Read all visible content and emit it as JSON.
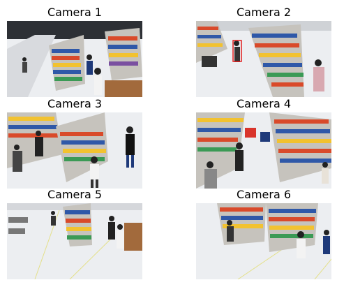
{
  "figure": {
    "cameras": [
      {
        "label": "Camera 1"
      },
      {
        "label": "Camera 2"
      },
      {
        "label": "Camera 3"
      },
      {
        "label": "Camera 4"
      },
      {
        "label": "Camera 5"
      },
      {
        "label": "Camera 6"
      }
    ]
  },
  "colors": {
    "floor": "#e9ebee",
    "shelf": "#c9c9c9",
    "product_a": "#2f58a8",
    "product_b": "#d94a2a",
    "product_c": "#f2c230",
    "person": "#222222",
    "highlight_box": "#e11d1d"
  }
}
